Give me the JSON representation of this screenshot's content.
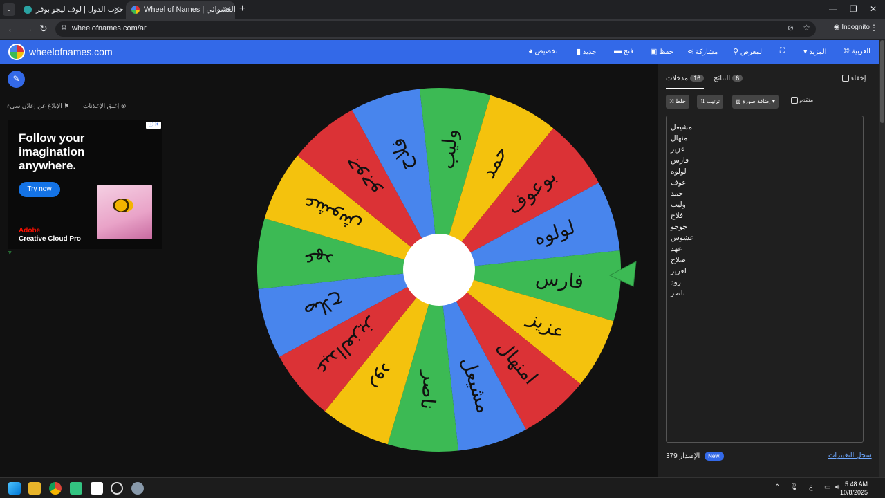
{
  "browser": {
    "tabs": [
      {
        "title": "لعبة حرب الدول | لوف ليجو بوفر"
      },
      {
        "title": "Wheel of Names | اسم العشوائي"
      }
    ],
    "url": "wheelofnames.com/ar",
    "incognito_label": "Incognito"
  },
  "header": {
    "site_name": "wheelofnames.com",
    "items": {
      "customize": "تخصيص",
      "new": "جديد",
      "open": "فتح",
      "save": "حفظ",
      "share": "مشاركة",
      "gallery": "المعرض",
      "more": "المزيد",
      "language": "العربية"
    }
  },
  "ads": {
    "report": "الإبلاغ عن إعلان سيء",
    "close": "إغلق الإعلانات",
    "headline": "Follow your imagination anywhere.",
    "cta": "Try now",
    "brand_line1": "Adobe",
    "brand_line2": "Creative Cloud Pro"
  },
  "wheel": {
    "colors": [
      "#3cba54",
      "#f4c20d",
      "#db3236",
      "#4885ed"
    ],
    "pointer_color": "#3cba54",
    "segments": [
      "فارس",
      "عزيز",
      "امنهال",
      "مشيعل",
      "ناصر",
      "رود",
      "عبدالعزيز",
      "صلاح",
      "عهد",
      "عشوش",
      "جوجو",
      "فلاح",
      "وليب",
      "حمد",
      "بوعوف",
      "لولوه"
    ]
  },
  "panel": {
    "tab_entries": "مدخلات",
    "entries_count": "16",
    "tab_results": "النتائج",
    "results_count": "6",
    "hide": "إخفاء",
    "shuffle": "خلط",
    "sort": "ترتيب",
    "add_image": "إضافة صورة",
    "advanced": "متقدم",
    "entries": [
      "مشيعل",
      "منهال",
      "عزيز",
      "فارس",
      "لولوه",
      "عوف",
      "حمد",
      "وليب",
      "فلاح",
      "جوجو",
      "عشوش",
      "عهد",
      "صلاح",
      "لعزيز",
      "رود",
      "ناصر"
    ],
    "version_label": "الإصدار",
    "version": "379",
    "new_badge": "New!",
    "changelog": "سجل التغييرات"
  },
  "taskbar": {
    "time": "5:48 AM",
    "date": "10/8/2025",
    "lang": "ع"
  }
}
